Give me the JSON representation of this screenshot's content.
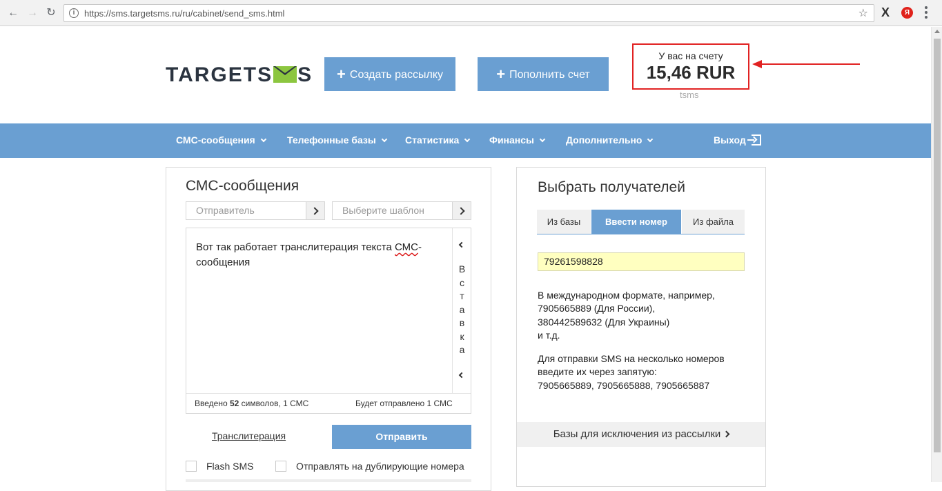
{
  "browser": {
    "url": "https://sms.targetsms.ru/ru/cabinet/send_sms.html",
    "ext_x": "X",
    "ext_ya": "Я"
  },
  "header": {
    "logo_left": "TARGETS",
    "logo_right": "S",
    "create_label": "Создать рассылку",
    "topup_label": "Пополнить счет",
    "balance_label": "У вас на счету",
    "balance_value": "15,46 RUR",
    "balance_sub": "tsms"
  },
  "nav": {
    "items": [
      "СМС-сообщения",
      "Телефонные базы",
      "Статистика",
      "Финансы",
      "Дополнительно"
    ],
    "exit": "Выход"
  },
  "compose": {
    "title": "СМС-сообщения",
    "sender_placeholder": "Отправитель",
    "template_placeholder": "Выберите шаблон",
    "message_part1": "Вот так работает транслитерация текста ",
    "message_spell": "СМС",
    "message_part2": "-сообщения",
    "insert_letters": [
      "В",
      "с",
      "т",
      "а",
      "в",
      "к",
      "а"
    ],
    "counter_prefix": "Введено ",
    "counter_chars": "52",
    "counter_mid": " символов, ",
    "counter_sms": "1 СМС",
    "sent_prefix": "Будет отправлено ",
    "sent_sms": "1 СМС",
    "translit_label": "Транслитерация",
    "send_label": "Отправить",
    "flash_label": "Flash SMS",
    "dup_label": "Отправлять на дублирующие номера"
  },
  "recipients": {
    "title": "Выбрать получателей",
    "tabs": [
      "Из базы",
      "Ввести номер",
      "Из файла"
    ],
    "active_tab": 1,
    "phone_value": "79261598828",
    "help1": [
      "В международном формате, например,",
      "7905665889 (Для России),",
      "380442589632 (Для Украины)",
      "и т.д."
    ],
    "help2": [
      "Для отправки SMS на несколько номеров",
      "введите их через запятую:",
      "7905665889, 7905665888, 7905665887"
    ],
    "exclusions_label": "Базы для исключения из рассылки"
  },
  "colors": {
    "accent": "#6a9fd2",
    "highlight": "#e12222",
    "logo_green": "#8cc63f",
    "input_yellow": "#ffffc0"
  }
}
